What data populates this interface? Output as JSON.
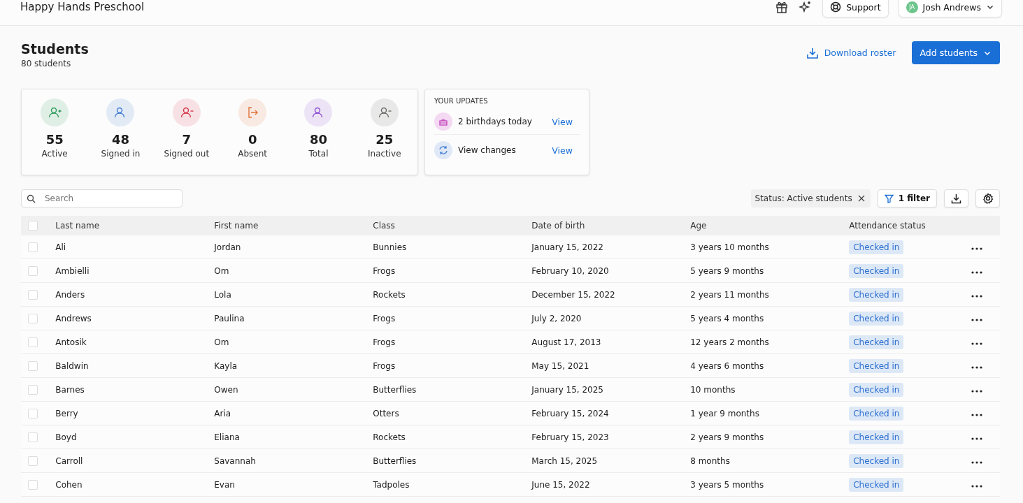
{
  "top_bar": {
    "title": "Happy Hands Preschool",
    "support": "Support",
    "user": {
      "initials": "JA",
      "name": "Josh Andrews"
    }
  },
  "header": {
    "title": "Students",
    "count": "80 students",
    "download": "Download roster",
    "add": "Add students"
  },
  "stats": [
    {
      "value": "55",
      "label": "Active",
      "kind": "person-plus",
      "color": "#2e9a5a"
    },
    {
      "value": "48",
      "label": "Signed in",
      "kind": "person",
      "color": "#3a78d4"
    },
    {
      "value": "7",
      "label": "Signed out",
      "kind": "person-minus",
      "color": "#d6364a"
    },
    {
      "value": "0",
      "label": "Absent",
      "kind": "exit",
      "color": "#e0733a"
    },
    {
      "value": "80",
      "label": "Total",
      "kind": "person",
      "color": "#8a48d0"
    },
    {
      "value": "25",
      "label": "Inactive",
      "kind": "person-minus",
      "color": "#6b6b66"
    }
  ],
  "updates": {
    "title": "YOUR UPDATES",
    "items": [
      {
        "kind": "cake",
        "text": "2 birthdays today",
        "link": "View"
      },
      {
        "kind": "refresh",
        "text": "View changes",
        "link": "View"
      }
    ]
  },
  "toolbar": {
    "search_placeholder": "Search",
    "filter_chip": "Status: Active students",
    "filter_button": "1 filter"
  },
  "table": {
    "select_all_checked": false,
    "columns": [
      "Last name",
      "First name",
      "Class",
      "Date of birth",
      "Age",
      "Attendance status"
    ],
    "rows": [
      {
        "checked": false,
        "cells": [
          "Ali",
          "Jordan",
          "Bunnies",
          "January 15, 2022",
          "3 years 10 months"
        ],
        "status": "Checked in"
      },
      {
        "checked": false,
        "cells": [
          "Ambielli",
          "Om",
          "Frogs",
          "February 10, 2020",
          "5 years 9 months"
        ],
        "status": "Checked in"
      },
      {
        "checked": false,
        "cells": [
          "Anders",
          "Lola",
          "Rockets",
          "December 15, 2022",
          "2 years 11 months"
        ],
        "status": "Checked in"
      },
      {
        "checked": false,
        "cells": [
          "Andrews",
          "Paulina",
          "Frogs",
          "July 2, 2020",
          "5 years 4 months"
        ],
        "status": "Checked in"
      },
      {
        "checked": false,
        "cells": [
          "Antosik",
          "Om",
          "Frogs",
          "August 17, 2013",
          "12 years 2 months"
        ],
        "status": "Checked in"
      },
      {
        "checked": false,
        "cells": [
          "Baldwin",
          "Kayla",
          "Frogs",
          "May 15, 2021",
          "4 years 6 months"
        ],
        "status": "Checked in"
      },
      {
        "checked": false,
        "cells": [
          "Barnes",
          "Owen",
          "Butterflies",
          "January 15, 2025",
          "10 months"
        ],
        "status": "Checked in"
      },
      {
        "checked": false,
        "cells": [
          "Berry",
          "Aria",
          "Otters",
          "February 15, 2024",
          "1 year 9 months"
        ],
        "status": "Checked in"
      },
      {
        "checked": false,
        "cells": [
          "Boyd",
          "Eliana",
          "Rockets",
          "February 15, 2023",
          "2 years 9 months"
        ],
        "status": "Checked in"
      },
      {
        "checked": false,
        "cells": [
          "Carroll",
          "Savannah",
          "Butterflies",
          "March 15, 2025",
          "8 months"
        ],
        "status": "Checked in"
      },
      {
        "checked": false,
        "cells": [
          "Cohen",
          "Evan",
          "Tadpoles",
          "June 15, 2022",
          "3 years 5 months"
        ],
        "status": "Checked in"
      }
    ]
  }
}
